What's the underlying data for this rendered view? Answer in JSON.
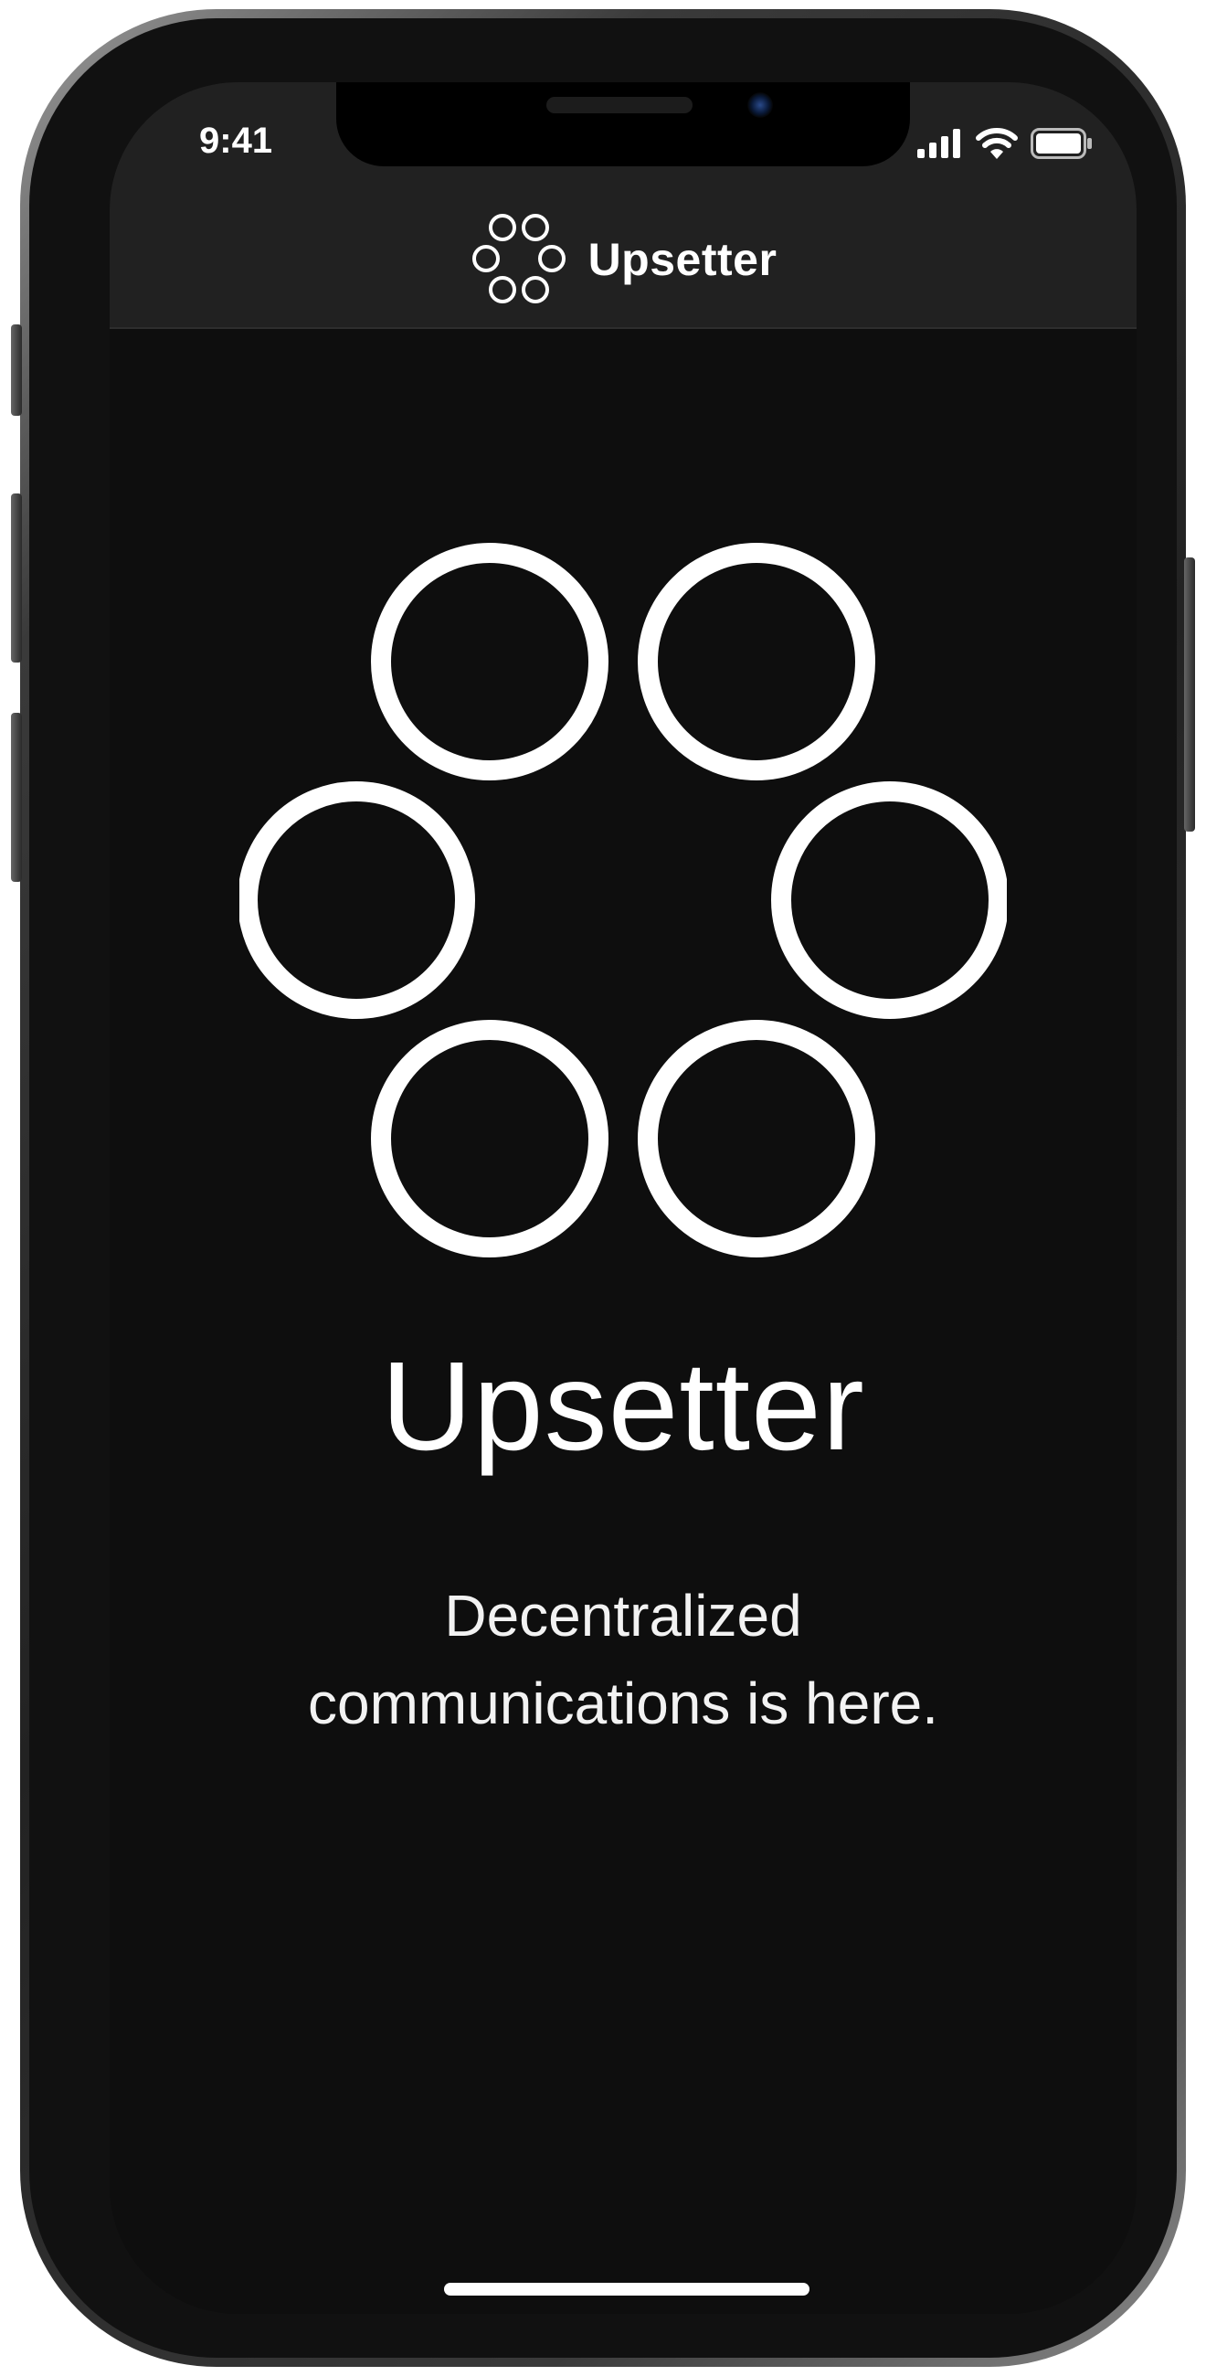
{
  "status_bar": {
    "time": "9:41",
    "icons": [
      "signal-icon",
      "wifi-icon",
      "battery-icon"
    ]
  },
  "nav_bar": {
    "title": "Upsetter",
    "logo_icon": "six-circles-logo-icon"
  },
  "hero": {
    "logo_icon": "six-circles-logo-icon",
    "title": "Upsetter",
    "subtitle_line1": "Decentralized",
    "subtitle_line2": "communications is here."
  },
  "colors": {
    "background": "#0e0e0e",
    "nav_background": "#212121",
    "foreground": "#ffffff"
  }
}
